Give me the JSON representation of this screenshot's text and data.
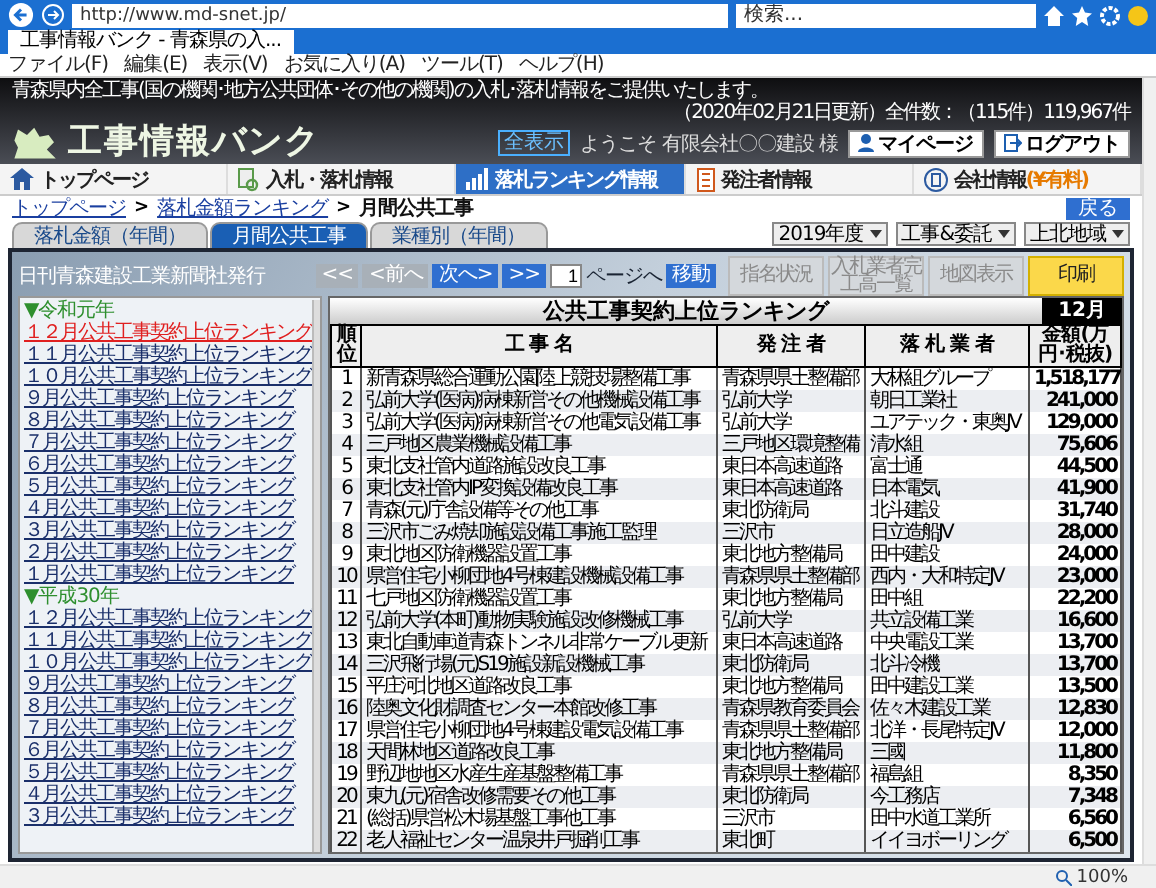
{
  "browser": {
    "address": "http://www.md-snet.jp/",
    "search_placeholder": "検索...",
    "tab_title": "工事情報バンク - 青森県の入...",
    "menu": [
      "ファイル(F)",
      "編集(E)",
      "表示(V)",
      "お気に入り(A)",
      "ツール(T)",
      "ヘルプ(H)"
    ],
    "zoom": "100%"
  },
  "site": {
    "notice": "青森県内全工事(国の機関･地方公共団体･その他の機関)の入札･落札情報をご提供いたします。",
    "updated": "（2020年02月21日更新）全件数：（115件）119,967件",
    "logo": "工事情報バンク",
    "buttons": [
      {
        "label": "マイページ",
        "kind": "user"
      },
      {
        "label": "ログアウト",
        "kind": "logout"
      }
    ],
    "badge": "全表示",
    "welcome": "ようこそ 有限会社〇〇建設 様"
  },
  "nav": [
    {
      "label": "トップページ",
      "kind": "home",
      "selected": false
    },
    {
      "label": "入札・落札情報",
      "kind": "search",
      "selected": false
    },
    {
      "label": "落札ランキング情報",
      "kind": "chart",
      "selected": true
    },
    {
      "label": "発注者情報",
      "kind": "document",
      "selected": false
    },
    {
      "label": "会社情報",
      "note": "(¥有料)",
      "kind": "company",
      "selected": false
    }
  ],
  "breadcrumb": {
    "items": [
      "トップページ",
      "落札金額ランキング",
      "月間公共工事"
    ],
    "separator": ">"
  },
  "back_button": "戻る",
  "tabs": [
    {
      "label": "落札金額（年間）",
      "selected": false
    },
    {
      "label": "月間公共工事",
      "selected": true
    },
    {
      "label": "業種別（年間）",
      "selected": false
    }
  ],
  "filters": [
    "2019年度",
    "工事&委託",
    "上北地域"
  ],
  "publisher": "日刊青森建設工業新聞社発行",
  "actions": [
    {
      "label": "指名状況",
      "disabled": true
    },
    {
      "label": "入札業者完工高一覧",
      "disabled": true
    },
    {
      "label": "地図表示",
      "disabled": true
    },
    {
      "label": "印刷",
      "disabled": false
    }
  ],
  "pager": {
    "buttons": [
      {
        "label": "<<",
        "disabled": true
      },
      {
        "label": "<前へ",
        "disabled": true
      },
      {
        "label": "次へ>",
        "disabled": false
      },
      {
        "label": ">>",
        "disabled": false
      }
    ],
    "page": "1",
    "page_label": "ページへ",
    "go": "移動"
  },
  "sidebar": {
    "groups": [
      {
        "label": "▼令和元年",
        "items": [
          {
            "label": "１２月公共工事契約上位ランキング",
            "selected": true
          },
          {
            "label": "１１月公共工事契約上位ランキング",
            "selected": false
          },
          {
            "label": "１０月公共工事契約上位ランキング",
            "selected": false
          },
          {
            "label": "９月公共工事契約上位ランキング",
            "selected": false
          },
          {
            "label": "８月公共工事契約上位ランキング",
            "selected": false
          },
          {
            "label": "７月公共工事契約上位ランキング",
            "selected": false
          },
          {
            "label": "６月公共工事契約上位ランキング",
            "selected": false
          },
          {
            "label": "５月公共工事契約上位ランキング",
            "selected": false
          },
          {
            "label": "４月公共工事契約上位ランキング",
            "selected": false
          },
          {
            "label": "３月公共工事契約上位ランキング",
            "selected": false
          },
          {
            "label": "２月公共工事契約上位ランキング",
            "selected": false
          },
          {
            "label": "１月公共工事契約上位ランキング",
            "selected": false
          }
        ]
      },
      {
        "label": "▼平成30年",
        "items": [
          {
            "label": "１２月公共工事契約上位ランキング",
            "selected": false
          },
          {
            "label": "１１月公共工事契約上位ランキング",
            "selected": false
          },
          {
            "label": "１０月公共工事契約上位ランキング",
            "selected": false
          },
          {
            "label": "９月公共工事契約上位ランキング",
            "selected": false
          },
          {
            "label": "８月公共工事契約上位ランキング",
            "selected": false
          },
          {
            "label": "７月公共工事契約上位ランキング",
            "selected": false
          },
          {
            "label": "６月公共工事契約上位ランキング",
            "selected": false
          },
          {
            "label": "５月公共工事契約上位ランキング",
            "selected": false
          },
          {
            "label": "４月公共工事契約上位ランキング",
            "selected": false
          },
          {
            "label": "３月公共工事契約上位ランキング",
            "selected": false
          }
        ]
      }
    ]
  },
  "ranking": {
    "title": "公共工事契約上位ランキング",
    "month": "12月",
    "columns": [
      "順位",
      "工 事 名",
      "発 注 者",
      "落 札 業 者",
      "金額(万円･税抜)"
    ],
    "rows": [
      [
        "1",
        "新青森県総合運動公園陸上競技場整備工事",
        "青森県県土整備部",
        "大林組グループ",
        "1,518,177"
      ],
      [
        "2",
        "弘前大学(医病)病棟新営その他機械設備工事",
        "弘前大学",
        "朝日工業社",
        "241,000"
      ],
      [
        "3",
        "弘前大学(医病)病棟新営その他電気設備工事",
        "弘前大学",
        "ユアテック・東奥JV",
        "129,000"
      ],
      [
        "4",
        "三戸地区農業機械設備工事",
        "三戸地区環境整備",
        "清水組",
        "75,606"
      ],
      [
        "5",
        "東北支社管内道路施設改良工事",
        "東日本高速道路",
        "富士通",
        "44,500"
      ],
      [
        "6",
        "東北支社管内IP変換設備改良工事",
        "東日本高速道路",
        "日本電気",
        "41,900"
      ],
      [
        "7",
        "青森(元)庁舎設備等その他工事",
        "東北防衛局",
        "北斗建設",
        "31,740"
      ],
      [
        "8",
        "三沢市ごみ焼却施設設備工事施工監理",
        "三沢市",
        "日立造船JV",
        "28,000"
      ],
      [
        "9",
        "東北地区防衛機器設置工事",
        "東北地方整備局",
        "田中建設",
        "24,000"
      ],
      [
        "10",
        "県営住宅小柳団地4号棟建設機械設備工事",
        "青森県県土整備部",
        "西内・大和特定JV",
        "23,000"
      ],
      [
        "11",
        "七戸地区防衛機器設置工事",
        "東北地方整備局",
        "田中組",
        "22,200"
      ],
      [
        "12",
        "弘前大学(本町)動物実験施設改修機械工事",
        "弘前大学",
        "共立設備工業",
        "16,600"
      ],
      [
        "13",
        "東北自動車道青森トンネル非常ケーブル更新",
        "東日本高速道路",
        "中央電設工業",
        "13,700"
      ],
      [
        "14",
        "三沢飛行場(元)S19施設新設機械工事",
        "東北防衛局",
        "北斗冷機",
        "13,700"
      ],
      [
        "15",
        "平庄河北地区道路改良工事",
        "東北地方整備局",
        "田中建設工業",
        "13,500"
      ],
      [
        "16",
        "陸奥文化財調査センター本館改修工事",
        "青森県教育委員会",
        "佐々木建設工業",
        "12,830"
      ],
      [
        "17",
        "県営住宅小柳団地4号棟建設電気設備工事",
        "青森県県土整備部",
        "北洋・長尾特定JV",
        "12,000"
      ],
      [
        "18",
        "天間林地区道路改良工事",
        "東北地方整備局",
        "三國",
        "11,800"
      ],
      [
        "19",
        "野辺地地区水産生産基盤整備工事",
        "青森県県土整備部",
        "福島組",
        "8,350"
      ],
      [
        "20",
        "東九(元)宿舎改修需要その他工事",
        "東北防衛局",
        "今工務店",
        "7,348"
      ],
      [
        "21",
        "(総括)県営松木場基盤工事他工事",
        "三沢市",
        "田中水道工業所",
        "6,560"
      ],
      [
        "22",
        "老人福祉センター温泉井戸掘削工事",
        "東北町",
        "イイヨボーリング",
        "6,500"
      ]
    ]
  }
}
